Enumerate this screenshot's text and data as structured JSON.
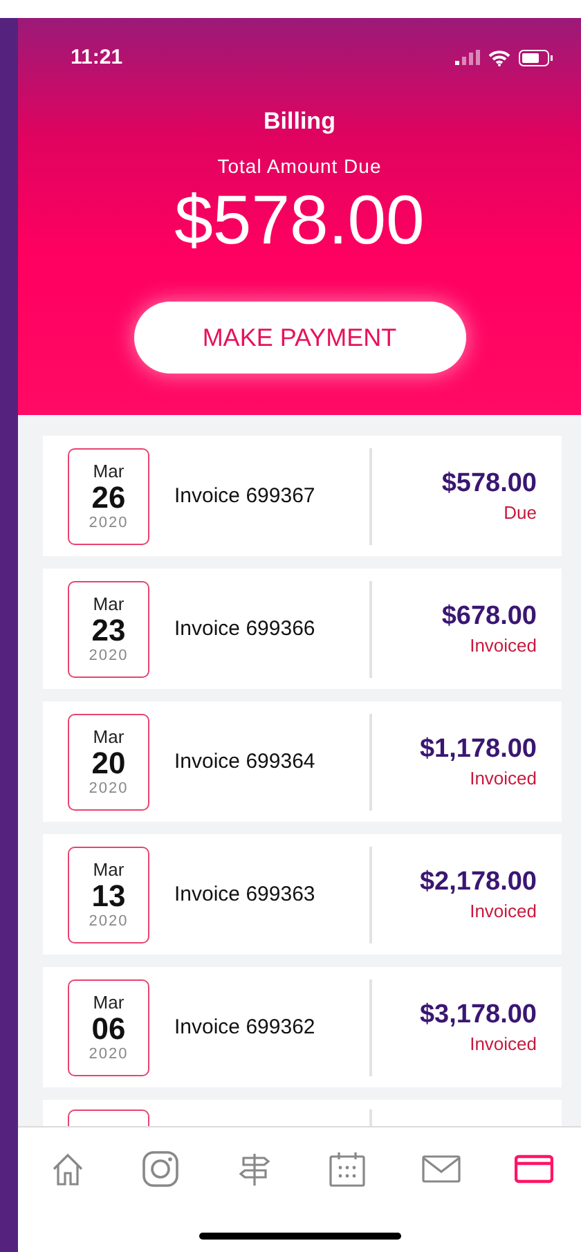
{
  "status_bar": {
    "time": "11:21"
  },
  "header": {
    "title": "Billing",
    "subtitle": "Total Amount Due",
    "amount": "$578.00",
    "button": "MAKE PAYMENT"
  },
  "invoices": [
    {
      "month": "Mar",
      "day": "26",
      "year": "2020",
      "name": "Invoice 699367",
      "amount": "$578.00",
      "status": "Due"
    },
    {
      "month": "Mar",
      "day": "23",
      "year": "2020",
      "name": "Invoice 699366",
      "amount": "$678.00",
      "status": "Invoiced"
    },
    {
      "month": "Mar",
      "day": "20",
      "year": "2020",
      "name": "Invoice 699364",
      "amount": "$1,178.00",
      "status": "Invoiced"
    },
    {
      "month": "Mar",
      "day": "13",
      "year": "2020",
      "name": "Invoice 699363",
      "amount": "$2,178.00",
      "status": "Invoiced"
    },
    {
      "month": "Mar",
      "day": "06",
      "year": "2020",
      "name": "Invoice 699362",
      "amount": "$3,178.00",
      "status": "Invoiced"
    }
  ],
  "tab_bar": [
    {
      "kind": "home",
      "selected": false
    },
    {
      "kind": "camera",
      "selected": false
    },
    {
      "kind": "signpost",
      "selected": false
    },
    {
      "kind": "calendar",
      "selected": false
    },
    {
      "kind": "mail",
      "selected": false
    },
    {
      "kind": "card",
      "selected": true
    }
  ]
}
